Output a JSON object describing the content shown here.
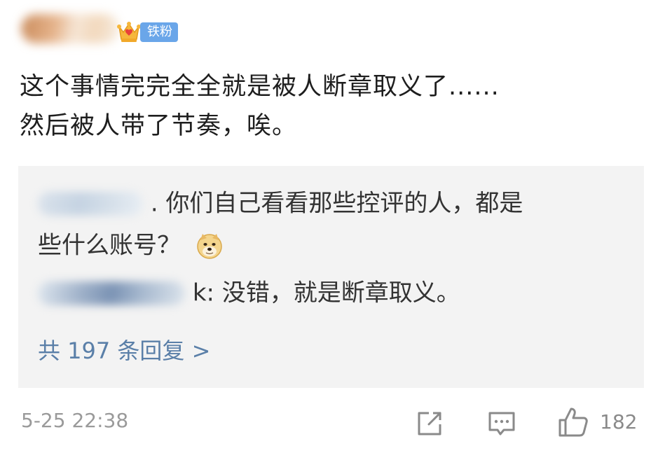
{
  "post": {
    "badge_label": "铁粉",
    "text_lines": [
      "这个事情完完全全就是被人断章取义了......",
      "然后被人带了节奏，唉。"
    ]
  },
  "replies": {
    "items": [
      {
        "name_suffix": ".",
        "text_line1": "你们自己看看那些控评的人，都是",
        "text_line2": "些什么账号？"
      },
      {
        "name_suffix": "k:",
        "text_line1": "没错，就是断章取义。"
      }
    ],
    "more_label": "共 197 条回复 >"
  },
  "footer": {
    "timestamp": "5-25 22:38",
    "like_count": "182"
  },
  "colors": {
    "badge": "#6aa6e9",
    "link": "#5a7fa8",
    "reply_bg": "#f3f3f3",
    "meta": "#9a9a9a"
  },
  "icons": {
    "badge_icon": "crown-icon",
    "emoji": "doge-icon",
    "share": "share-icon",
    "comment": "comment-icon",
    "like": "like-icon"
  }
}
